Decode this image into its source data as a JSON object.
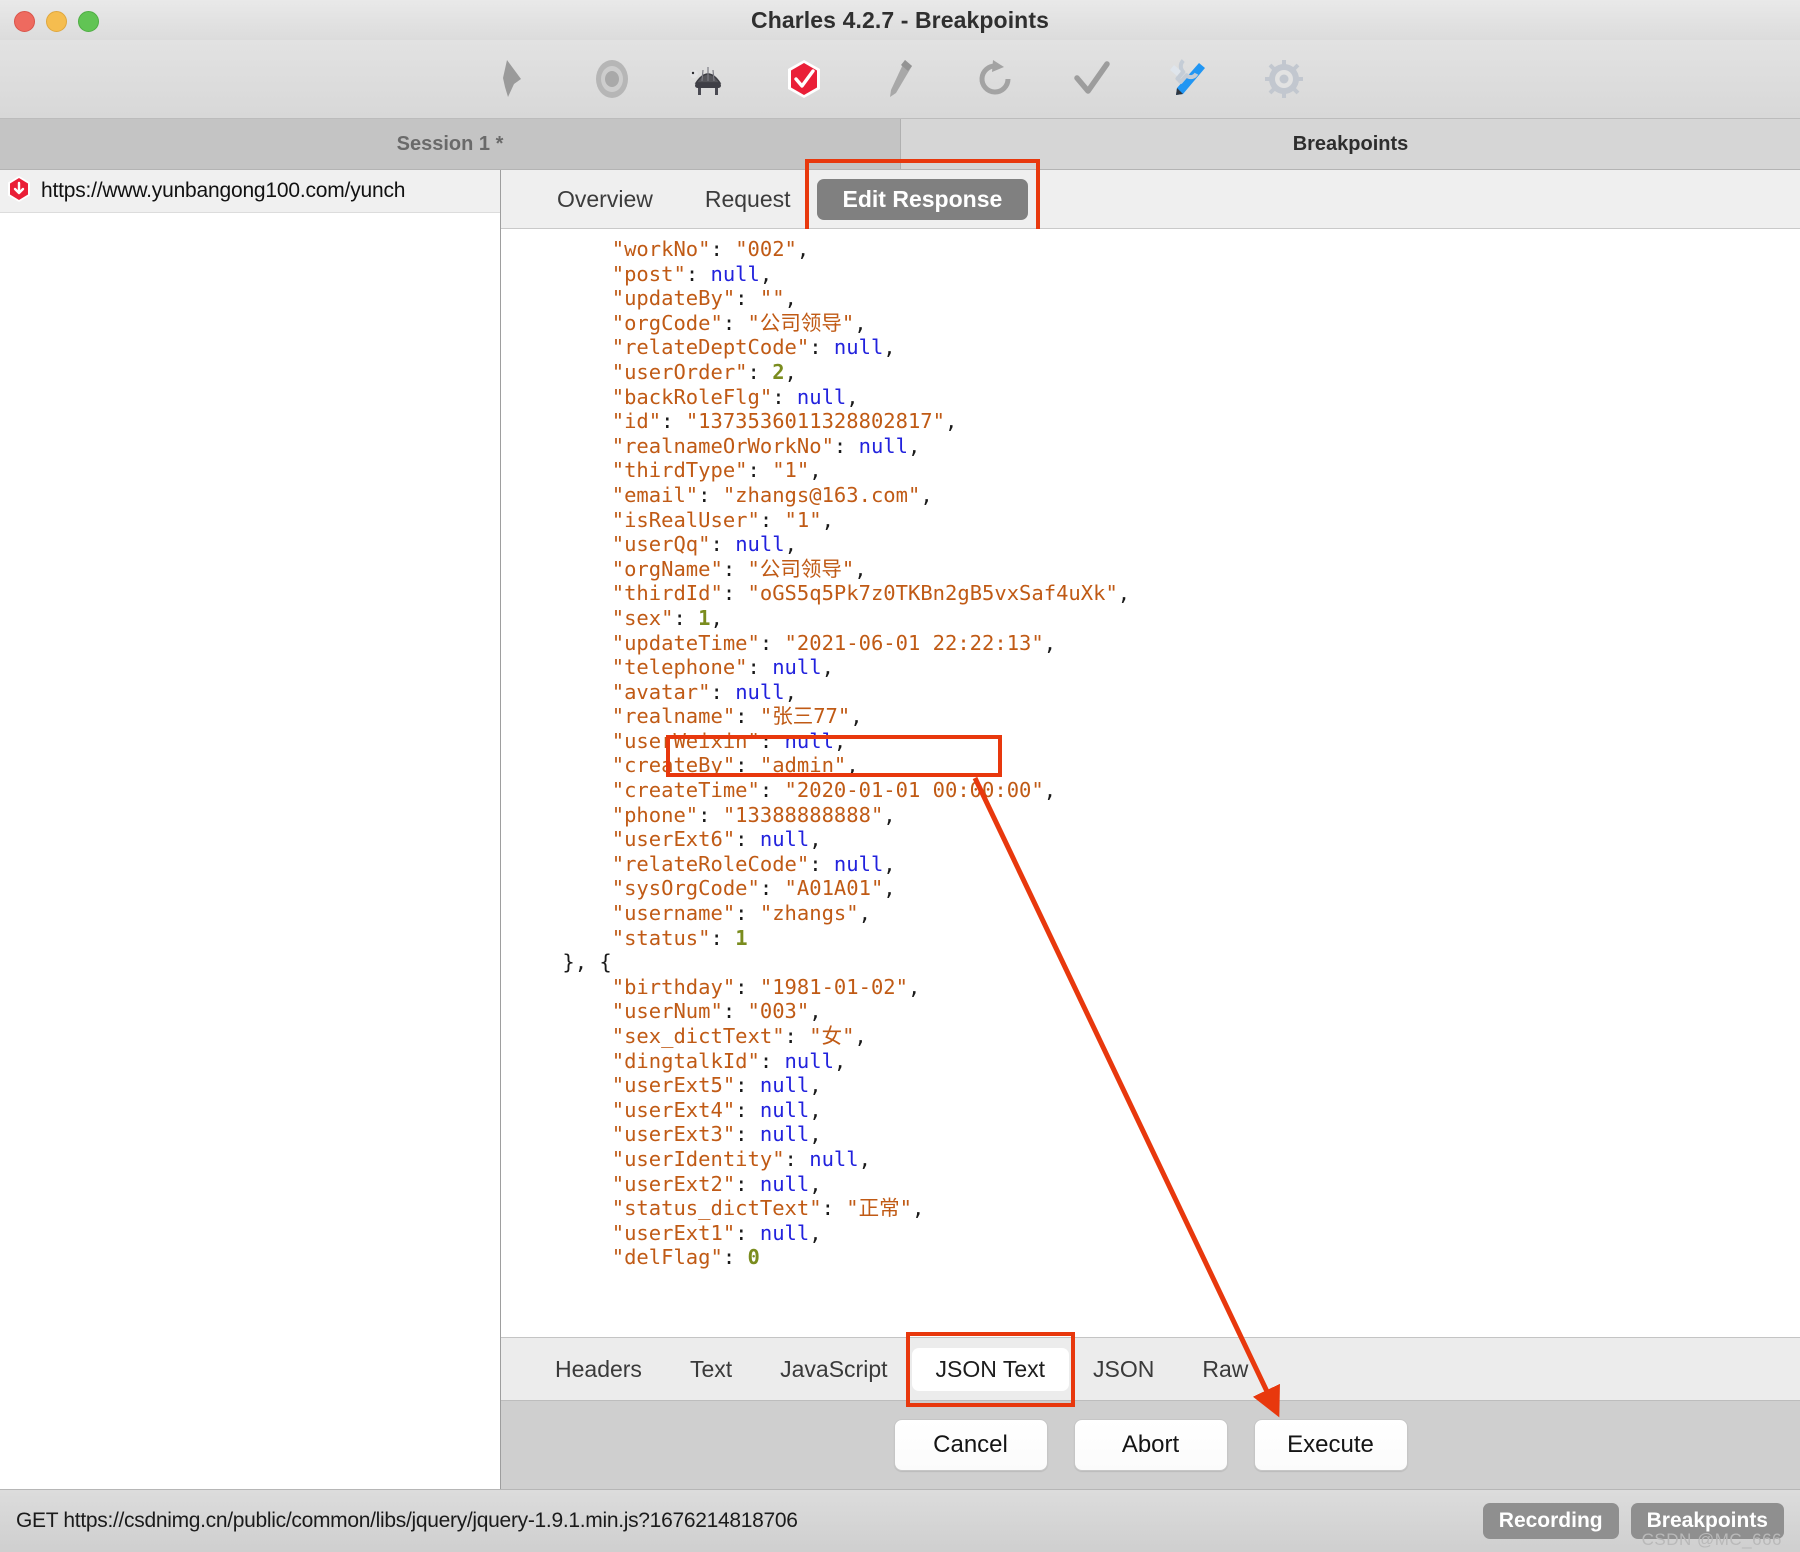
{
  "window": {
    "title": "Charles 4.2.7 - Breakpoints",
    "traffic_lights": [
      "close",
      "minimize",
      "maximize"
    ]
  },
  "toolbar": {
    "items": [
      {
        "name": "clear-icon",
        "label": "Clear"
      },
      {
        "name": "record-icon",
        "label": "Start/Stop Recording"
      },
      {
        "name": "throttle-turtle-icon",
        "label": "Throttle"
      },
      {
        "name": "breakpoints-stop-icon",
        "label": "Breakpoints"
      },
      {
        "name": "compose-pen-icon",
        "label": "Compose"
      },
      {
        "name": "repeat-refresh-icon",
        "label": "Repeat"
      },
      {
        "name": "validate-check-icon",
        "label": "Validate"
      },
      {
        "name": "tools-icon",
        "label": "Tools"
      },
      {
        "name": "settings-gear-icon",
        "label": "Settings"
      }
    ]
  },
  "tabstrip": {
    "session_tab": "Session 1 *",
    "breakpoints_tab": "Breakpoints"
  },
  "left_pane": {
    "rows": [
      {
        "icon": "breakpoint-stop-icon",
        "url": "https://www.yunbangong100.com/yunch"
      }
    ]
  },
  "detail_tabs": {
    "tabs": [
      "Overview",
      "Request",
      "Edit Response"
    ],
    "active": "Edit Response"
  },
  "content_tabs": {
    "tabs": [
      "Headers",
      "Text",
      "JavaScript",
      "JSON Text",
      "JSON",
      "Raw"
    ],
    "active": "JSON Text"
  },
  "actions": {
    "cancel": "Cancel",
    "abort": "Abort",
    "execute": "Execute"
  },
  "statusbar": {
    "request": "GET https://csdnimg.cn/public/common/libs/jquery/jquery-1.9.1.min.js?1676214818706",
    "badges": [
      "Recording",
      "Breakpoints"
    ],
    "watermark": "CSDN @MC_666"
  },
  "annotations": {
    "accent_color": "#e8380d",
    "boxes": [
      "edit-response-tab",
      "realname-line",
      "json-text-tab"
    ],
    "arrow": {
      "from": "realname-line",
      "to": "execute-button"
    }
  },
  "json_body": {
    "lines": [
      [
        {
          "t": "p",
          "v": "        "
        },
        {
          "t": "k",
          "v": "\"workNo\""
        },
        {
          "t": "p",
          "v": ": "
        },
        {
          "t": "s",
          "v": "\"002\""
        },
        {
          "t": "p",
          "v": ","
        }
      ],
      [
        {
          "t": "p",
          "v": "        "
        },
        {
          "t": "k",
          "v": "\"post\""
        },
        {
          "t": "p",
          "v": ": "
        },
        {
          "t": "n",
          "v": "null"
        },
        {
          "t": "p",
          "v": ","
        }
      ],
      [
        {
          "t": "p",
          "v": "        "
        },
        {
          "t": "k",
          "v": "\"updateBy\""
        },
        {
          "t": "p",
          "v": ": "
        },
        {
          "t": "s",
          "v": "\"\""
        },
        {
          "t": "p",
          "v": ","
        }
      ],
      [
        {
          "t": "p",
          "v": "        "
        },
        {
          "t": "k",
          "v": "\"orgCode\""
        },
        {
          "t": "p",
          "v": ": "
        },
        {
          "t": "s",
          "v": "\"公司领导\""
        },
        {
          "t": "p",
          "v": ","
        }
      ],
      [
        {
          "t": "p",
          "v": "        "
        },
        {
          "t": "k",
          "v": "\"relateDeptCode\""
        },
        {
          "t": "p",
          "v": ": "
        },
        {
          "t": "n",
          "v": "null"
        },
        {
          "t": "p",
          "v": ","
        }
      ],
      [
        {
          "t": "p",
          "v": "        "
        },
        {
          "t": "k",
          "v": "\"userOrder\""
        },
        {
          "t": "p",
          "v": ": "
        },
        {
          "t": "num",
          "v": "2"
        },
        {
          "t": "p",
          "v": ","
        }
      ],
      [
        {
          "t": "p",
          "v": "        "
        },
        {
          "t": "k",
          "v": "\"backRoleFlg\""
        },
        {
          "t": "p",
          "v": ": "
        },
        {
          "t": "n",
          "v": "null"
        },
        {
          "t": "p",
          "v": ","
        }
      ],
      [
        {
          "t": "p",
          "v": "        "
        },
        {
          "t": "k",
          "v": "\"id\""
        },
        {
          "t": "p",
          "v": ": "
        },
        {
          "t": "s",
          "v": "\"1373536011328802817\""
        },
        {
          "t": "p",
          "v": ","
        }
      ],
      [
        {
          "t": "p",
          "v": "        "
        },
        {
          "t": "k",
          "v": "\"realnameOrWorkNo\""
        },
        {
          "t": "p",
          "v": ": "
        },
        {
          "t": "n",
          "v": "null"
        },
        {
          "t": "p",
          "v": ","
        }
      ],
      [
        {
          "t": "p",
          "v": "        "
        },
        {
          "t": "k",
          "v": "\"thirdType\""
        },
        {
          "t": "p",
          "v": ": "
        },
        {
          "t": "s",
          "v": "\"1\""
        },
        {
          "t": "p",
          "v": ","
        }
      ],
      [
        {
          "t": "p",
          "v": "        "
        },
        {
          "t": "k",
          "v": "\"email\""
        },
        {
          "t": "p",
          "v": ": "
        },
        {
          "t": "s",
          "v": "\"zhangs@163.com\""
        },
        {
          "t": "p",
          "v": ","
        }
      ],
      [
        {
          "t": "p",
          "v": "        "
        },
        {
          "t": "k",
          "v": "\"isRealUser\""
        },
        {
          "t": "p",
          "v": ": "
        },
        {
          "t": "s",
          "v": "\"1\""
        },
        {
          "t": "p",
          "v": ","
        }
      ],
      [
        {
          "t": "p",
          "v": "        "
        },
        {
          "t": "k",
          "v": "\"userQq\""
        },
        {
          "t": "p",
          "v": ": "
        },
        {
          "t": "n",
          "v": "null"
        },
        {
          "t": "p",
          "v": ","
        }
      ],
      [
        {
          "t": "p",
          "v": "        "
        },
        {
          "t": "k",
          "v": "\"orgName\""
        },
        {
          "t": "p",
          "v": ": "
        },
        {
          "t": "s",
          "v": "\"公司领导\""
        },
        {
          "t": "p",
          "v": ","
        }
      ],
      [
        {
          "t": "p",
          "v": "        "
        },
        {
          "t": "k",
          "v": "\"thirdId\""
        },
        {
          "t": "p",
          "v": ": "
        },
        {
          "t": "s",
          "v": "\"oGS5q5Pk7z0TKBn2gB5vxSaf4uXk\""
        },
        {
          "t": "p",
          "v": ","
        }
      ],
      [
        {
          "t": "p",
          "v": "        "
        },
        {
          "t": "k",
          "v": "\"sex\""
        },
        {
          "t": "p",
          "v": ": "
        },
        {
          "t": "num",
          "v": "1"
        },
        {
          "t": "p",
          "v": ","
        }
      ],
      [
        {
          "t": "p",
          "v": "        "
        },
        {
          "t": "k",
          "v": "\"updateTime\""
        },
        {
          "t": "p",
          "v": ": "
        },
        {
          "t": "s",
          "v": "\"2021-06-01 22:22:13\""
        },
        {
          "t": "p",
          "v": ","
        }
      ],
      [
        {
          "t": "p",
          "v": "        "
        },
        {
          "t": "k",
          "v": "\"telephone\""
        },
        {
          "t": "p",
          "v": ": "
        },
        {
          "t": "n",
          "v": "null"
        },
        {
          "t": "p",
          "v": ","
        }
      ],
      [
        {
          "t": "p",
          "v": "        "
        },
        {
          "t": "k",
          "v": "\"avatar\""
        },
        {
          "t": "p",
          "v": ": "
        },
        {
          "t": "n",
          "v": "null"
        },
        {
          "t": "p",
          "v": ","
        }
      ],
      [
        {
          "t": "p",
          "v": "        "
        },
        {
          "t": "k",
          "v": "\"realname\""
        },
        {
          "t": "p",
          "v": ": "
        },
        {
          "t": "s",
          "v": "\"张三77\""
        },
        {
          "t": "p",
          "v": ","
        }
      ],
      [
        {
          "t": "p",
          "v": "        "
        },
        {
          "t": "k",
          "v": "\"userWeixin\""
        },
        {
          "t": "p",
          "v": ": "
        },
        {
          "t": "n",
          "v": "null"
        },
        {
          "t": "p",
          "v": ","
        }
      ],
      [
        {
          "t": "p",
          "v": "        "
        },
        {
          "t": "k",
          "v": "\"createBy\""
        },
        {
          "t": "p",
          "v": ": "
        },
        {
          "t": "s",
          "v": "\"admin\""
        },
        {
          "t": "p",
          "v": ","
        }
      ],
      [
        {
          "t": "p",
          "v": "        "
        },
        {
          "t": "k",
          "v": "\"createTime\""
        },
        {
          "t": "p",
          "v": ": "
        },
        {
          "t": "s",
          "v": "\"2020-01-01 00:00:00\""
        },
        {
          "t": "p",
          "v": ","
        }
      ],
      [
        {
          "t": "p",
          "v": "        "
        },
        {
          "t": "k",
          "v": "\"phone\""
        },
        {
          "t": "p",
          "v": ": "
        },
        {
          "t": "s",
          "v": "\"13388888888\""
        },
        {
          "t": "p",
          "v": ","
        }
      ],
      [
        {
          "t": "p",
          "v": "        "
        },
        {
          "t": "k",
          "v": "\"userExt6\""
        },
        {
          "t": "p",
          "v": ": "
        },
        {
          "t": "n",
          "v": "null"
        },
        {
          "t": "p",
          "v": ","
        }
      ],
      [
        {
          "t": "p",
          "v": "        "
        },
        {
          "t": "k",
          "v": "\"relateRoleCode\""
        },
        {
          "t": "p",
          "v": ": "
        },
        {
          "t": "n",
          "v": "null"
        },
        {
          "t": "p",
          "v": ","
        }
      ],
      [
        {
          "t": "p",
          "v": "        "
        },
        {
          "t": "k",
          "v": "\"sysOrgCode\""
        },
        {
          "t": "p",
          "v": ": "
        },
        {
          "t": "s",
          "v": "\"A01A01\""
        },
        {
          "t": "p",
          "v": ","
        }
      ],
      [
        {
          "t": "p",
          "v": "        "
        },
        {
          "t": "k",
          "v": "\"username\""
        },
        {
          "t": "p",
          "v": ": "
        },
        {
          "t": "s",
          "v": "\"zhangs\""
        },
        {
          "t": "p",
          "v": ","
        }
      ],
      [
        {
          "t": "p",
          "v": "        "
        },
        {
          "t": "k",
          "v": "\"status\""
        },
        {
          "t": "p",
          "v": ": "
        },
        {
          "t": "num",
          "v": "1"
        }
      ],
      [
        {
          "t": "p",
          "v": "    }, {"
        }
      ],
      [
        {
          "t": "p",
          "v": "        "
        },
        {
          "t": "k",
          "v": "\"birthday\""
        },
        {
          "t": "p",
          "v": ": "
        },
        {
          "t": "s",
          "v": "\"1981-01-02\""
        },
        {
          "t": "p",
          "v": ","
        }
      ],
      [
        {
          "t": "p",
          "v": "        "
        },
        {
          "t": "k",
          "v": "\"userNum\""
        },
        {
          "t": "p",
          "v": ": "
        },
        {
          "t": "s",
          "v": "\"003\""
        },
        {
          "t": "p",
          "v": ","
        }
      ],
      [
        {
          "t": "p",
          "v": "        "
        },
        {
          "t": "k",
          "v": "\"sex_dictText\""
        },
        {
          "t": "p",
          "v": ": "
        },
        {
          "t": "s",
          "v": "\"女\""
        },
        {
          "t": "p",
          "v": ","
        }
      ],
      [
        {
          "t": "p",
          "v": "        "
        },
        {
          "t": "k",
          "v": "\"dingtalkId\""
        },
        {
          "t": "p",
          "v": ": "
        },
        {
          "t": "n",
          "v": "null"
        },
        {
          "t": "p",
          "v": ","
        }
      ],
      [
        {
          "t": "p",
          "v": "        "
        },
        {
          "t": "k",
          "v": "\"userExt5\""
        },
        {
          "t": "p",
          "v": ": "
        },
        {
          "t": "n",
          "v": "null"
        },
        {
          "t": "p",
          "v": ","
        }
      ],
      [
        {
          "t": "p",
          "v": "        "
        },
        {
          "t": "k",
          "v": "\"userExt4\""
        },
        {
          "t": "p",
          "v": ": "
        },
        {
          "t": "n",
          "v": "null"
        },
        {
          "t": "p",
          "v": ","
        }
      ],
      [
        {
          "t": "p",
          "v": "        "
        },
        {
          "t": "k",
          "v": "\"userExt3\""
        },
        {
          "t": "p",
          "v": ": "
        },
        {
          "t": "n",
          "v": "null"
        },
        {
          "t": "p",
          "v": ","
        }
      ],
      [
        {
          "t": "p",
          "v": "        "
        },
        {
          "t": "k",
          "v": "\"userIdentity\""
        },
        {
          "t": "p",
          "v": ": "
        },
        {
          "t": "n",
          "v": "null"
        },
        {
          "t": "p",
          "v": ","
        }
      ],
      [
        {
          "t": "p",
          "v": "        "
        },
        {
          "t": "k",
          "v": "\"userExt2\""
        },
        {
          "t": "p",
          "v": ": "
        },
        {
          "t": "n",
          "v": "null"
        },
        {
          "t": "p",
          "v": ","
        }
      ],
      [
        {
          "t": "p",
          "v": "        "
        },
        {
          "t": "k",
          "v": "\"status_dictText\""
        },
        {
          "t": "p",
          "v": ": "
        },
        {
          "t": "s",
          "v": "\"正常\""
        },
        {
          "t": "p",
          "v": ","
        }
      ],
      [
        {
          "t": "p",
          "v": "        "
        },
        {
          "t": "k",
          "v": "\"userExt1\""
        },
        {
          "t": "p",
          "v": ": "
        },
        {
          "t": "n",
          "v": "null"
        },
        {
          "t": "p",
          "v": ","
        }
      ],
      [
        {
          "t": "p",
          "v": "        "
        },
        {
          "t": "k",
          "v": "\"delFlag\""
        },
        {
          "t": "p",
          "v": ": "
        },
        {
          "t": "num",
          "v": "0"
        }
      ]
    ]
  }
}
